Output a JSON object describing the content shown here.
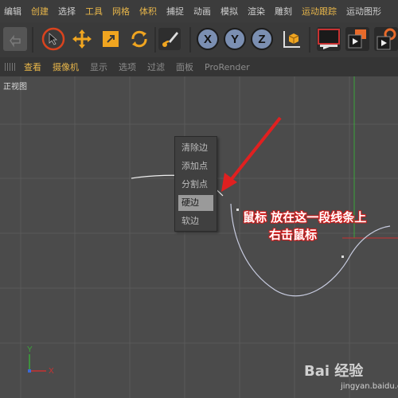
{
  "menubar": {
    "items": [
      {
        "label": "编辑",
        "accent": false
      },
      {
        "label": "创建",
        "accent": true
      },
      {
        "label": "选择",
        "accent": false
      },
      {
        "label": "工具",
        "accent": true
      },
      {
        "label": "网格",
        "accent": true
      },
      {
        "label": "体积",
        "accent": true
      },
      {
        "label": "捕捉",
        "accent": false
      },
      {
        "label": "动画",
        "accent": false
      },
      {
        "label": "模拟",
        "accent": false
      },
      {
        "label": "渲染",
        "accent": false
      },
      {
        "label": "雕刻",
        "accent": false
      },
      {
        "label": "运动跟踪",
        "accent": true
      },
      {
        "label": "运动图形",
        "accent": false
      }
    ]
  },
  "toolbar": {
    "axis_x": "X",
    "axis_y": "Y",
    "axis_z": "Z",
    "icons": [
      "undo-icon",
      "select-cursor-icon",
      "move-icon",
      "scale-icon",
      "rotate-icon",
      "live-selection-icon",
      "x-axis-icon",
      "y-axis-icon",
      "z-axis-icon",
      "coordinate-system-icon",
      "render-view-icon",
      "render-picture-icon",
      "render-settings-icon"
    ]
  },
  "viewbar": {
    "items": [
      {
        "label": "查看",
        "accent": true
      },
      {
        "label": "摄像机",
        "accent": true
      },
      {
        "label": "显示",
        "accent": false
      },
      {
        "label": "选项",
        "accent": false
      },
      {
        "label": "过滤",
        "accent": false
      },
      {
        "label": "面板",
        "accent": false
      },
      {
        "label": "ProRender",
        "accent": false
      }
    ]
  },
  "viewport": {
    "title": "正视图",
    "axis_labels": {
      "x": "X",
      "y": "Y"
    }
  },
  "context_menu": {
    "items": [
      {
        "label": "清除边",
        "selected": false
      },
      {
        "label": "添加点",
        "selected": false
      },
      {
        "label": "分割点",
        "selected": false
      },
      {
        "label": "硬边",
        "selected": true
      },
      {
        "label": "软边",
        "selected": false
      }
    ]
  },
  "annotation": {
    "line1": "鼠标 放在这一段线条上",
    "line2": "右击鼠标",
    "color": "#e02020"
  },
  "watermark": {
    "logo": "Bai 经验",
    "domain": "jingyan.baidu.com"
  },
  "colors": {
    "accent": "#e8b64a",
    "background": "#4b4b4b",
    "grid": "#5a5a5a",
    "spline": "#c8cce0",
    "axis_green": "#3aa63a",
    "axis_red": "#c83232"
  }
}
